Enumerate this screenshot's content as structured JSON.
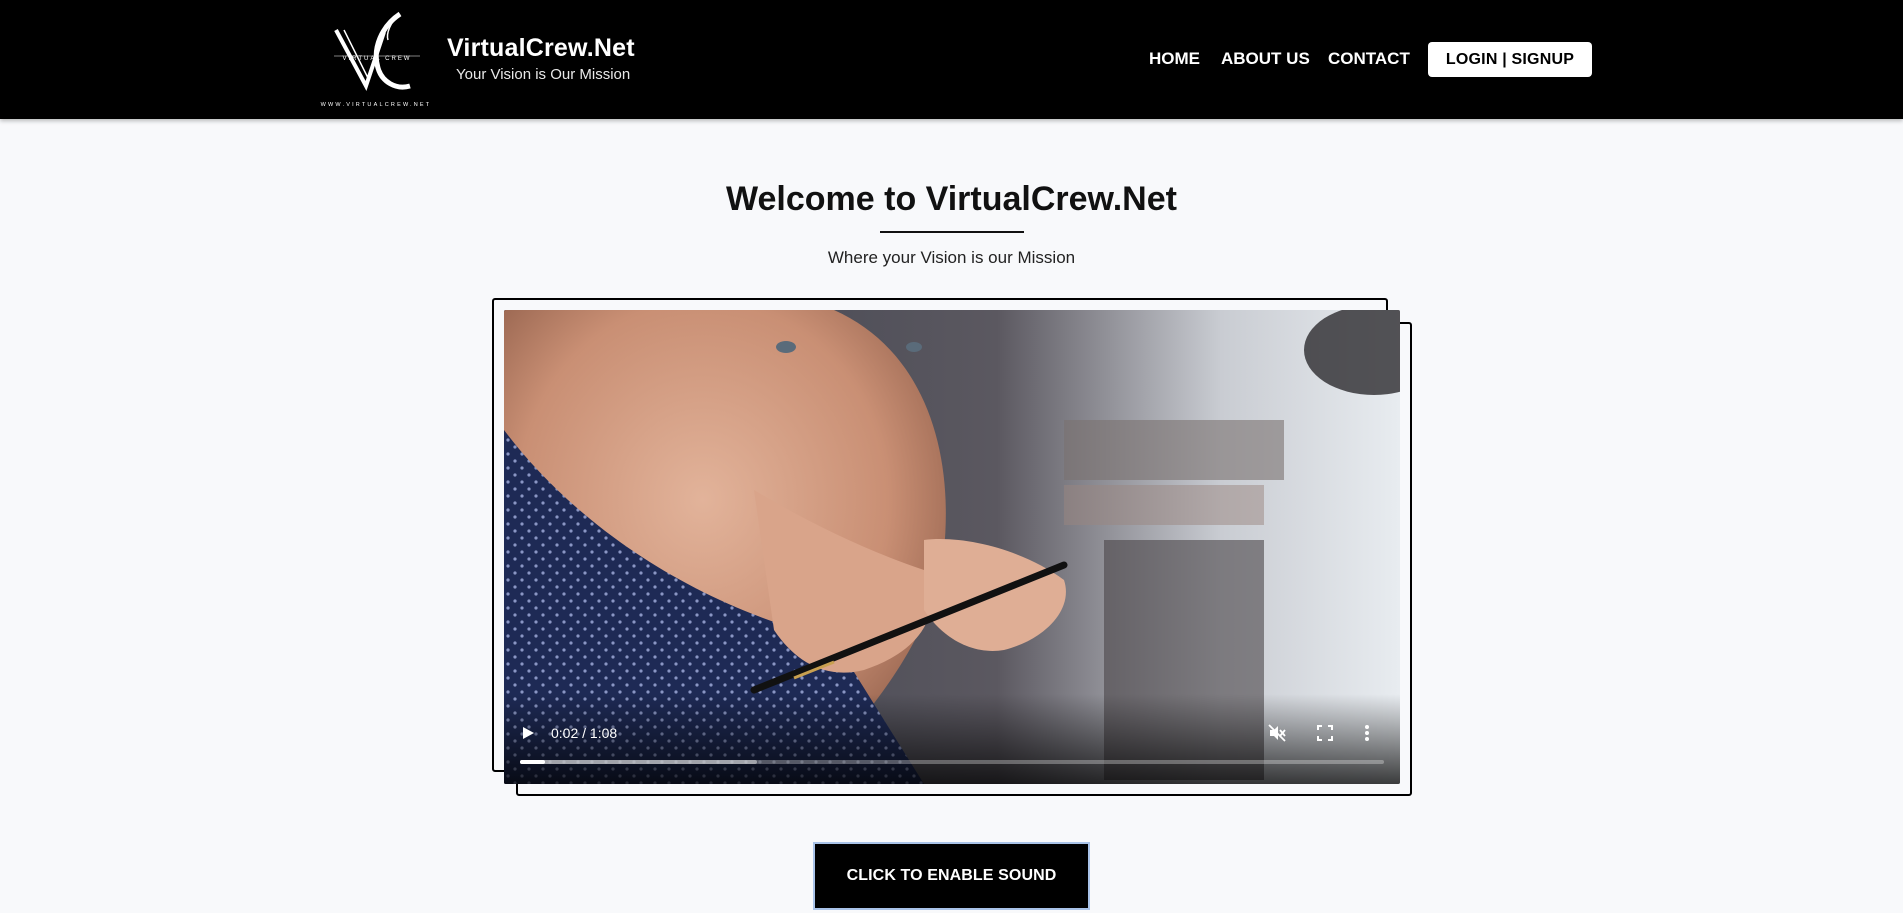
{
  "header": {
    "logo_icon": "vc-monogram-logo",
    "logo_text": "VIRTUAL CREW",
    "logo_url_text": "WWW.VIRTUALCREW.NET",
    "brand_title": "VirtualCrew.Net",
    "brand_tagline": "Your Vision is Our Mission",
    "nav": {
      "home": "HOME",
      "about": "ABOUT US",
      "contact": "CONTACT",
      "login": "LOGIN | SIGNUP"
    }
  },
  "hero": {
    "title": "Welcome to VirtualCrew.Net",
    "subtitle": "Where your Vision is our Mission"
  },
  "video": {
    "time_display": "0:02 / 1:08",
    "played_fraction": 0.029,
    "buffered_fraction": 0.274,
    "muted": true,
    "icons": [
      "play-icon",
      "muted-volume-icon",
      "fullscreen-icon",
      "more-options-icon"
    ]
  },
  "sound_button": {
    "label": "CLICK TO ENABLE SOUND"
  },
  "colors": {
    "header_bg": "#000000",
    "page_bg": "#f8f9fb",
    "button_border": "#a9c3e8"
  }
}
